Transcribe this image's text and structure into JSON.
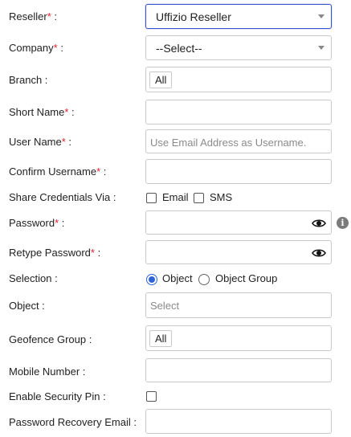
{
  "form": {
    "reseller": {
      "label": "Reseller",
      "req": "*",
      "suffix": " :",
      "value": "Uffizio Reseller"
    },
    "company": {
      "label": "Company",
      "req": "*",
      "suffix": " :",
      "value": "--Select--"
    },
    "branch": {
      "label": "Branch :",
      "tag": "All"
    },
    "short_name": {
      "label": "Short Name",
      "req": "*",
      "suffix": " :"
    },
    "user_name": {
      "label": "User Name",
      "req": "*",
      "suffix": " :",
      "placeholder": "Use Email Address as Username."
    },
    "confirm_username": {
      "label": "Confirm Username",
      "req": "*",
      "suffix": " :"
    },
    "share_credentials": {
      "label": "Share Credentials Via :",
      "options": [
        "Email",
        "SMS"
      ]
    },
    "password": {
      "label": "Password",
      "req": "*",
      "suffix": " :",
      "info": "i"
    },
    "retype_password": {
      "label": "Retype Password",
      "req": "*",
      "suffix": " :"
    },
    "selection": {
      "label": "Selection :",
      "options": [
        "Object",
        "Object Group"
      ],
      "selected": "Object"
    },
    "object": {
      "label": "Object :",
      "placeholder": "Select"
    },
    "geofence_group": {
      "label": "Geofence Group :",
      "tag": "All"
    },
    "mobile_number": {
      "label": "Mobile Number :"
    },
    "security_pin": {
      "label": "Enable Security Pin :"
    },
    "recovery_email": {
      "label": "Password Recovery Email :"
    }
  },
  "colors": {
    "required": "#e0212e",
    "accent": "#2d64d8",
    "focus_border": "#3a52c9"
  }
}
